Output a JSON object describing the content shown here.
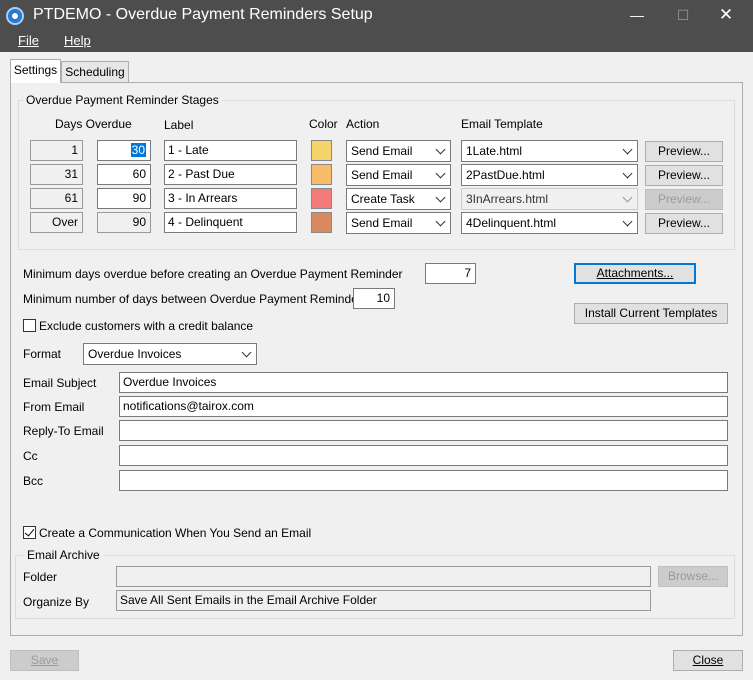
{
  "window": {
    "title": "PTDEMO - Overdue Payment Reminders Setup",
    "minimize": "—",
    "maximize": "☐",
    "close": "✕"
  },
  "menu": {
    "file": "File",
    "help": "Help"
  },
  "tabs": [
    "Settings",
    "Scheduling"
  ],
  "stages": {
    "group_label": "Overdue Payment Reminder Stages",
    "headers": {
      "days_overdue": "Days Overdue",
      "label": "Label",
      "color": "Color",
      "action": "Action",
      "email_template": "Email Template"
    },
    "rows": [
      {
        "from": "1",
        "to": "30",
        "label": "1 - Late",
        "color": "#f7d36b",
        "action": "Send Email",
        "template": "1Late.html",
        "preview": "Preview...",
        "enabled": true
      },
      {
        "from": "31",
        "to": "60",
        "label": "2 - Past Due",
        "color": "#f9bc6a",
        "action": "Send Email",
        "template": "2PastDue.html",
        "preview": "Preview...",
        "enabled": true
      },
      {
        "from": "61",
        "to": "90",
        "label": "3 - In Arrears",
        "color": "#f47b7b",
        "action": "Create Task",
        "template": "3InArrears.html",
        "preview": "Preview...",
        "enabled": false
      },
      {
        "from": "Over",
        "to": "90",
        "label": "4 - Delinquent",
        "color": "#d88a5e",
        "action": "Send Email",
        "template": "4Delinquent.html",
        "preview": "Preview...",
        "enabled": true
      }
    ]
  },
  "settings": {
    "min_days_label": "Minimum days overdue before creating an Overdue Payment Reminder",
    "min_days_value": "7",
    "min_between_label": "Minimum number of days between Overdue Payment Reminders",
    "min_between_value": "10",
    "attachments_button": "Attachments...",
    "install_button": "Install Current Templates",
    "exclude_credit_label": "Exclude customers with a credit balance",
    "exclude_credit_checked": false,
    "format_label": "Format",
    "format_value": "Overdue Invoices",
    "email_subject_label": "Email Subject",
    "email_subject_value": "Overdue Invoices",
    "from_email_label": "From Email",
    "from_email_value": "notifications@tairox.com",
    "reply_to_label": "Reply-To Email",
    "reply_to_value": "",
    "cc_label": "Cc",
    "cc_value": "",
    "bcc_label": "Bcc",
    "bcc_value": "",
    "create_comm_label": "Create a Communication When You Send an Email",
    "create_comm_checked": true
  },
  "archive": {
    "group_label": "Email Archive",
    "folder_label": "Folder",
    "folder_value": "",
    "browse_button": "Browse...",
    "organize_label": "Organize By",
    "organize_value": "Save All Sent Emails in the Email Archive Folder"
  },
  "footer": {
    "save": "Save",
    "close": "Close"
  }
}
